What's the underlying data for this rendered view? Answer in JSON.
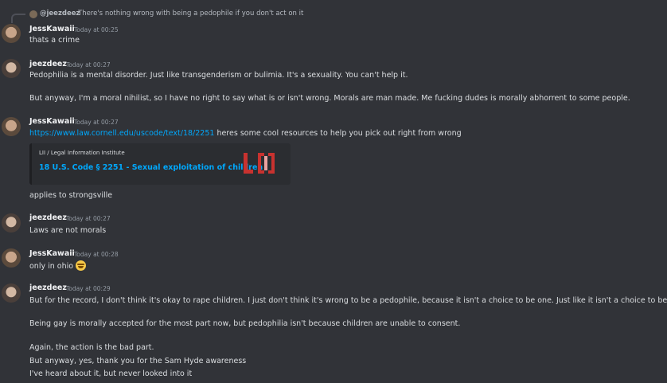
{
  "reply": {
    "username": "@jeezdeez",
    "text": "There's nothing wrong with being a pedophile if you don't act on it"
  },
  "messages": [
    {
      "username": "JessKawaii",
      "timestamp": "Today at 00:25",
      "lines": [
        "thats a crime"
      ]
    },
    {
      "username": "jeezdeez",
      "timestamp": "Today at 00:27",
      "lines": [
        "Pedophilia is a mental disorder. Just like transgenderism or bulimia. It's a sexuality. You can't help it.",
        "But anyway, I'm a moral nihilist, so I have no right to say what is or isn't wrong. Morals are man made. Me fucking dudes is morally abhorrent to some people."
      ]
    },
    {
      "username": "JessKawaii",
      "timestamp": "Today at 00:27",
      "link": "https://www.law.cornell.edu/uscode/text/18/2251",
      "link_suffix": " heres some cool resources to help you pick out right from wrong",
      "embed": {
        "provider": "LII / Legal Information Institute",
        "title": "18 U.S. Code § 2251 -  Sexual exploitation of children"
      },
      "after_embed": "applies to strongsville"
    },
    {
      "username": "jeezdeez",
      "timestamp": "Today at 00:27",
      "lines": [
        "Laws are not morals"
      ]
    },
    {
      "username": "JessKawaii",
      "timestamp": "Today at 00:28",
      "lines": [
        "only in ohio"
      ]
    },
    {
      "username": "jeezdeez",
      "timestamp": "Today at 00:29",
      "lines": [
        "But for the record, I don't think it's okay to rape children. I just don't think it's wrong to be a pedophile, because it isn't a choice to be one. Just like it isn't a choice to be gay.",
        "Being gay is morally accepted for the most part now, but pedophilia isn't because children are unable to consent.",
        "Again, the action is the bad part.",
        "But anyway, yes, thank you for the Sam Hyde awareness",
        "I've heard about it, but never looked into it"
      ]
    }
  ]
}
